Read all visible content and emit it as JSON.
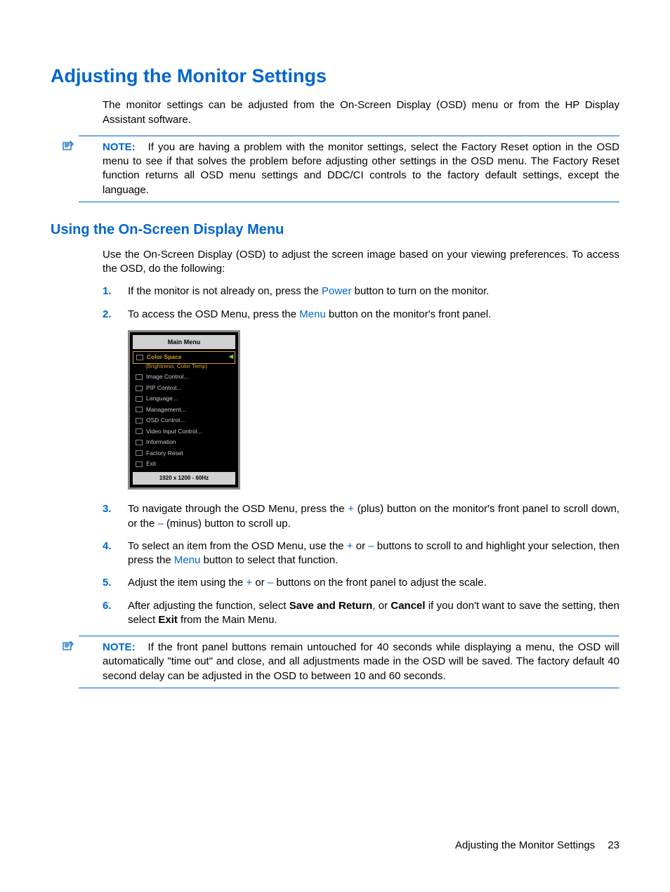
{
  "heading_main": "Adjusting the Monitor Settings",
  "intro_text": "The monitor settings can be adjusted from the On-Screen Display (OSD) menu or from the HP Display Assistant software.",
  "note1": {
    "label": "NOTE:",
    "text": "If you are having a problem with the monitor settings, select the Factory Reset option in the OSD menu to see if that solves the problem before adjusting other settings in the OSD menu. The Factory Reset function returns all OSD menu settings and DDC/CI controls to the factory default settings, except the language."
  },
  "heading_sub": "Using the On-Screen Display Menu",
  "sub_intro": "Use the On-Screen Display (OSD) to adjust the screen image based on your viewing preferences. To access the OSD, do the following:",
  "steps": {
    "s1": {
      "num": "1.",
      "a": "If the monitor is not already on, press the ",
      "kw": "Power",
      "b": " button to turn on the monitor."
    },
    "s2": {
      "num": "2.",
      "a": "To access the OSD Menu, press the ",
      "kw": "Menu",
      "b": " button on the monitor's front panel."
    },
    "s3": {
      "num": "3.",
      "a": "To navigate through the OSD Menu, press the ",
      "kw1": "+",
      "b": " (plus) button on the monitor's front panel to scroll down, or the ",
      "kw2": "–",
      "c": " (minus) button to scroll up."
    },
    "s4": {
      "num": "4.",
      "a": "To select an item from the OSD Menu, use the ",
      "kw1": "+",
      "b": " or ",
      "kw2": "–",
      "c": " buttons to scroll to and highlight your selection, then press the ",
      "kw3": "Menu",
      "d": " button to select that function."
    },
    "s5": {
      "num": "5.",
      "a": "Adjust the item using the ",
      "kw1": "+",
      "b": " or ",
      "kw2": "–",
      "c": " buttons on the front panel to adjust the scale."
    },
    "s6": {
      "num": "6.",
      "a": "After adjusting the function, select ",
      "b1": "Save and Return",
      "b": ", or ",
      "b2": "Cancel",
      "c": " if you don't want to save the setting, then select ",
      "b3": "Exit",
      "d": " from the Main Menu."
    }
  },
  "osd": {
    "title": "Main Menu",
    "selected": "Color Space",
    "selected_sub": "(Brightness, Color Temp)",
    "items": [
      "Image Control...",
      "PIP Control...",
      "Language...",
      "Management...",
      "OSD Control...",
      "Video Input Control...",
      "Information",
      "Factory Reset",
      "Exit"
    ],
    "footer": "1920 x 1200 - 60Hz"
  },
  "note2": {
    "label": "NOTE:",
    "text": "If the front panel buttons remain untouched for 40 seconds while displaying a menu, the OSD will automatically \"time out\" and close, and all adjustments made in the OSD will be saved. The factory default 40 second delay can be adjusted in the OSD to between 10 and 60 seconds."
  },
  "footer": {
    "section": "Adjusting the Monitor Settings",
    "page": "23"
  }
}
